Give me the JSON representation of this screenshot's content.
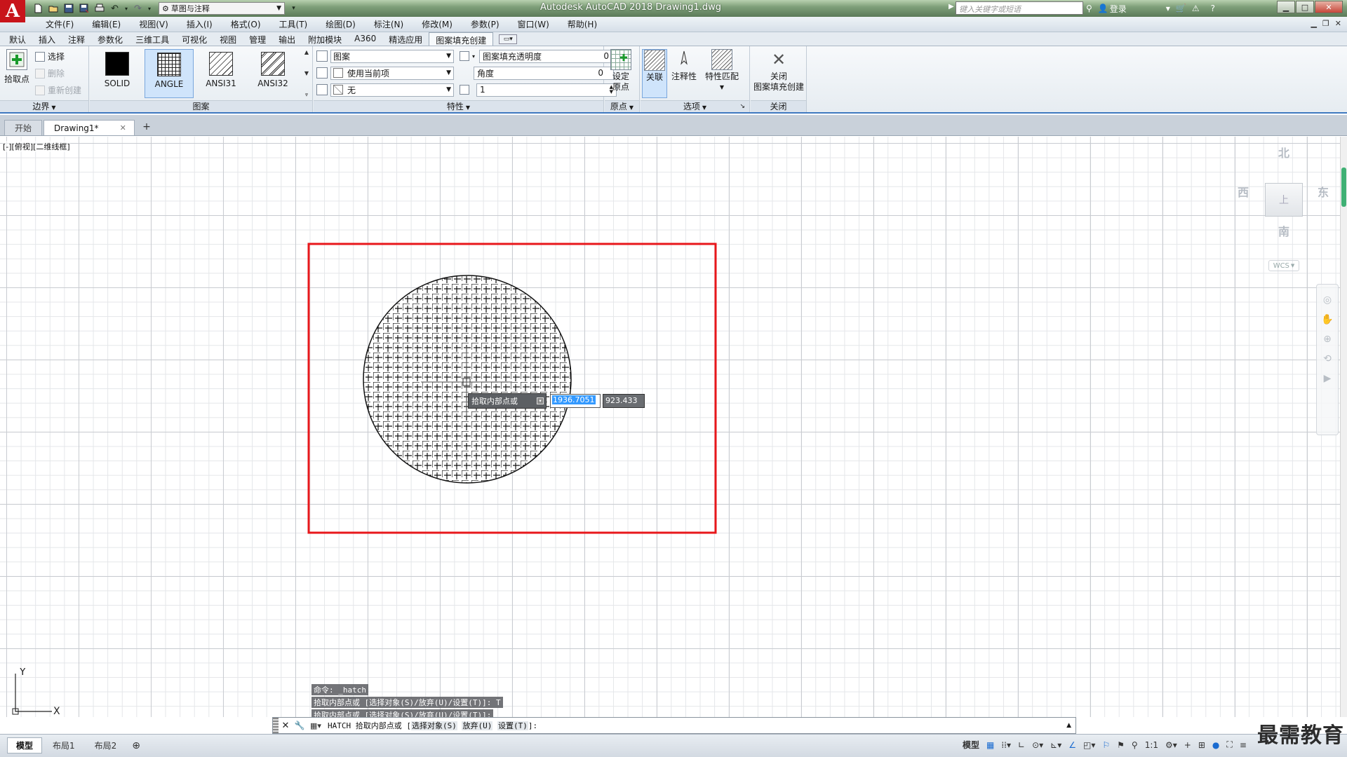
{
  "window": {
    "title": "Autodesk AutoCAD 2018    Drawing1.dwg",
    "workspace": "草图与注释",
    "search_placeholder": "键入关键字或短语",
    "login": "登录"
  },
  "menu": [
    "文件(F)",
    "编辑(E)",
    "视图(V)",
    "插入(I)",
    "格式(O)",
    "工具(T)",
    "绘图(D)",
    "标注(N)",
    "修改(M)",
    "参数(P)",
    "窗口(W)",
    "帮助(H)"
  ],
  "ribbon_tabs": [
    "默认",
    "插入",
    "注释",
    "参数化",
    "三维工具",
    "可视化",
    "视图",
    "管理",
    "输出",
    "附加模块",
    "A360",
    "精选应用",
    "图案填充创建"
  ],
  "ribbon": {
    "boundary": {
      "pick_point": "拾取点",
      "select": "选择",
      "remove": "删除",
      "recreate": "重新创建",
      "title": "边界"
    },
    "pattern": {
      "swatches": [
        "SOLID",
        "ANGLE",
        "ANSI31",
        "ANSI32"
      ],
      "active": "ANGLE",
      "title": "图案"
    },
    "properties": {
      "type": "图案",
      "color": "使用当前项",
      "background": "无",
      "transparency_label": "图案填充透明度",
      "transparency_value": "0",
      "angle_label": "角度",
      "angle_value": "0",
      "scale_value": "1",
      "title": "特性"
    },
    "origin": {
      "set_origin_1": "设定",
      "set_origin_2": "原点",
      "title": "原点"
    },
    "options": {
      "associative": "关联",
      "annotative": "注释性",
      "match_props": "特性匹配",
      "title": "选项"
    },
    "close": {
      "close_1": "关闭",
      "close_2": "图案填充创建",
      "title": "关闭"
    }
  },
  "doc_tabs": {
    "start": "开始",
    "drawing": "Drawing1*"
  },
  "viewport_label": "[-][俯视][二维线框]",
  "viewcube": {
    "north": "北",
    "south": "南",
    "east": "东",
    "west": "西",
    "top": "上",
    "wcs": "WCS"
  },
  "dynamic_input": {
    "prompt": "拾取内部点或",
    "x_value": "1936.7051",
    "y_value": "923.433"
  },
  "command_history": [
    "命令:  _hatch",
    "拾取内部点或 [选择对象(S)/放弃(U)/设置(T)]: T",
    "拾取内部点或 [选择对象(S)/放弃(U)/设置(T)]:"
  ],
  "command_line": {
    "prefix": "HATCH 拾取内部点或 [",
    "opt1": "选择对象(S)",
    "opt2": "放弃(U)",
    "opt3": "设置(T)",
    "suffix": "]:"
  },
  "ucs": {
    "y": "Y",
    "x": "X"
  },
  "layout_tabs": [
    "模型",
    "布局1",
    "布局2"
  ],
  "status": {
    "model": "模型",
    "scale": "1:1"
  },
  "watermark": "最需教育",
  "colors": {
    "highlight_rect": "#e8171b",
    "ribbon_accent": "#3e78bf",
    "logo": "#c8141b"
  }
}
